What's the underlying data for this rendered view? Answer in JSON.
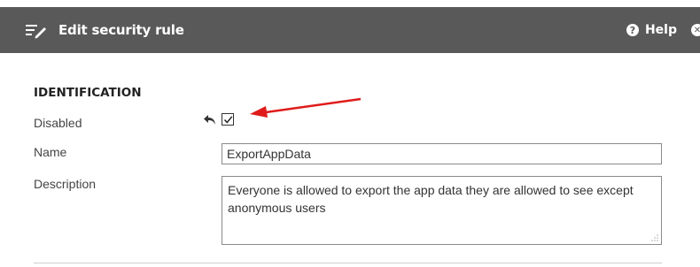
{
  "header": {
    "title": "Edit security rule",
    "help_label": "Help",
    "help_glyph": "?",
    "close_glyph": "✕",
    "icons": {
      "edit": "edit-list-icon",
      "help": "help-icon",
      "close": "close-icon"
    },
    "background": "#595959"
  },
  "identification": {
    "section_title": "IDENTIFICATION",
    "disabled": {
      "label": "Disabled",
      "checked": true,
      "revert_icon": "revert-arrow-icon"
    },
    "name": {
      "label": "Name",
      "value": "ExportAppData"
    },
    "description": {
      "label": "Description",
      "value": "Everyone is allowed to export the app data they are allowed to see except anonymous users"
    }
  },
  "annotation": {
    "arrow_color": "#e01b1b",
    "icon": "red-arrow-icon"
  }
}
